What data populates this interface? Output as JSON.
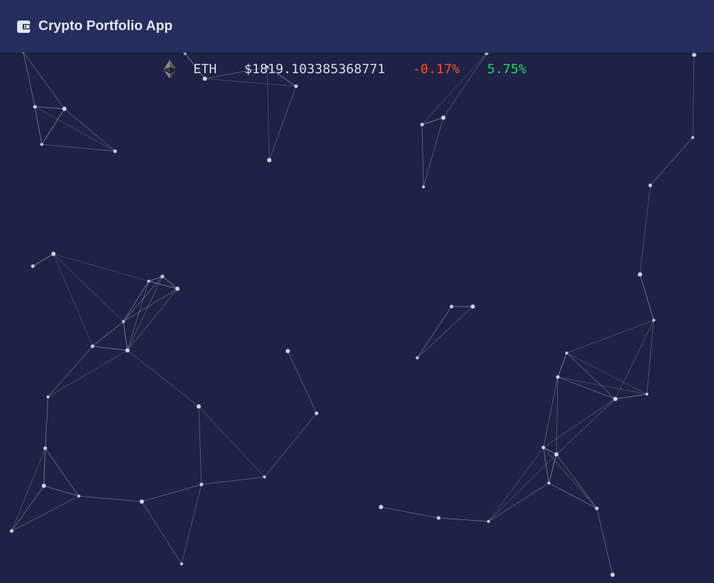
{
  "app": {
    "title": "Crypto Portfolio App",
    "icon": "wallet-icon"
  },
  "ticker": {
    "icon": "ethereum-icon",
    "symbol": "ETH",
    "price": "$1819.103385368771",
    "change_1": "-0.17%",
    "change_2": "5.75%"
  },
  "colors": {
    "background": "#1e2246",
    "header": "#262e5f",
    "negative": "#ff4e1f",
    "positive": "#19d85a"
  }
}
